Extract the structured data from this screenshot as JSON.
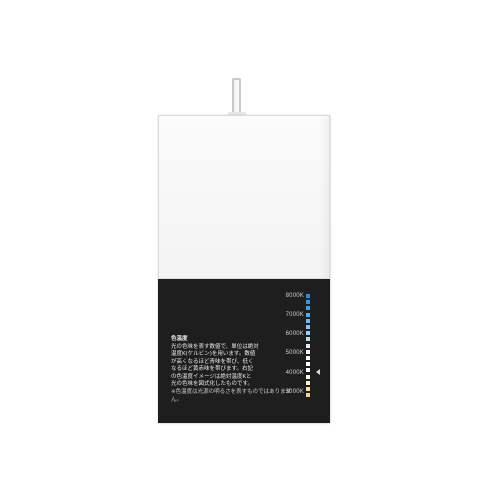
{
  "card": {
    "description": {
      "title": "色温度",
      "lines": [
        "光の色味を表す数値で、単位は絶対",
        "温度K(ケルビン)を用います。数値",
        "が高くなるほど青味を帯び、低く",
        "なるほど黄赤味を帯びます。右記",
        "の色温度イメージは絶対温度Kと",
        "光の色味を図式化したものです。"
      ],
      "note": "※色温度は光源の明るさを表すものではありません。"
    },
    "scale_labels": [
      "8000K",
      "7000K",
      "6000K",
      "5000K",
      "4000K",
      "3000K"
    ],
    "swatch_colors": [
      "#1f8fe0",
      "#2d98e4",
      "#3aa3e8",
      "#4eaeeb",
      "#66bcef",
      "#7fc7f1",
      "#98d1f3",
      "#b3def6",
      "#ddf0fb",
      "#f4f9fd",
      "#ffffff",
      "#ffffff",
      "#ffffff",
      "#fdf8ea",
      "#fbefcd",
      "#f7e3a8",
      "#f3d489"
    ],
    "pointer_position_k": 4000,
    "colors": {
      "card_white": "#f7f7f7",
      "card_black": "#1e1e1e"
    }
  }
}
